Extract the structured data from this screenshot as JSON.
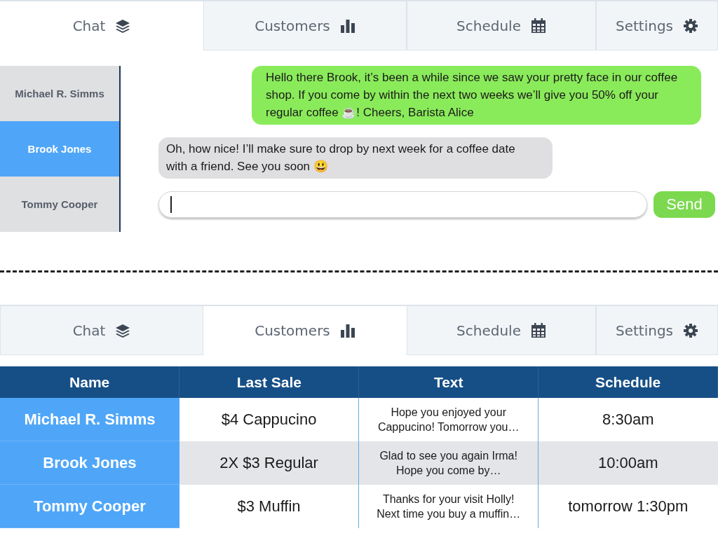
{
  "chat_view": {
    "tabs": [
      {
        "label": "Chat",
        "selected": true
      },
      {
        "label": "Customers",
        "selected": false
      },
      {
        "label": "Schedule",
        "selected": false
      },
      {
        "label": "Settings",
        "selected": false
      }
    ],
    "contacts": [
      {
        "name": "Michael R. Simms",
        "selected": false
      },
      {
        "name": "Brook Jones",
        "selected": true
      },
      {
        "name": "Tommy Cooper",
        "selected": false
      }
    ],
    "messages": [
      {
        "kind": "sent",
        "text": "Hello there Brook, it’s been a while since we saw your pretty face in our coffee shop. If you come by within the next two weeks we’ll give you 50% off your regular coffee ☕! Cheers, Barista Alice"
      },
      {
        "kind": "received",
        "text": "Oh, how nice! I’ll make sure to drop by next week for a coffee date with a friend. See you soon 😃"
      }
    ],
    "send_button": "Send"
  },
  "customers_view": {
    "tabs": [
      {
        "label": "Chat",
        "selected": false
      },
      {
        "label": "Customers",
        "selected": true
      },
      {
        "label": "Schedule",
        "selected": false
      },
      {
        "label": "Settings",
        "selected": false
      }
    ],
    "table": {
      "columns": [
        "Name",
        "Last Sale",
        "Text",
        "Schedule"
      ],
      "rows": [
        [
          "Michael R. Simms",
          "$4 Cappucino",
          "Hope you enjoyed your Cappucino! Tomorrow you…",
          "8:30am"
        ],
        [
          "Brook Jones",
          "2X $3 Regular",
          "Glad to see you again Irma! Hope you come by…",
          "10:00am"
        ],
        [
          "Tommy Cooper",
          "$3 Muffin",
          "Thanks for your visit Holly! Next time you buy a muffin…",
          "tomorrow 1:30pm"
        ]
      ]
    }
  }
}
